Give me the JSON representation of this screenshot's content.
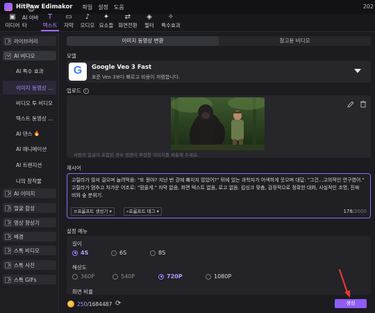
{
  "app": {
    "title": "HitPaw Edimakor",
    "menu": [
      "파일",
      "설정",
      "도움"
    ],
    "right_text": "202"
  },
  "toolbar": [
    {
      "icon": "media-icon",
      "glyph": "▣",
      "label": "미디어"
    },
    {
      "icon": "ai-avatar-icon",
      "glyph": "☺",
      "label": "AI 아바타"
    },
    {
      "icon": "text-icon",
      "glyph": "T",
      "label": "텍스트",
      "active": true
    },
    {
      "icon": "subtitle-icon",
      "glyph": "▭",
      "label": "자막"
    },
    {
      "icon": "audio-icon",
      "glyph": "♪",
      "label": "오디오"
    },
    {
      "icon": "elements-icon",
      "glyph": "✦",
      "label": "요소들"
    },
    {
      "icon": "transition-icon",
      "glyph": "⇄",
      "label": "화면전환"
    },
    {
      "icon": "filter-icon",
      "glyph": "◈",
      "label": "필터"
    },
    {
      "icon": "effects-icon",
      "glyph": "✧",
      "label": "특수효과"
    }
  ],
  "sidebar": {
    "library": "라이브러리",
    "ai_video": "AI 비디오",
    "sub_items": [
      "AI 특수 효과",
      "이미지 동영상 ...",
      "비디오 투 비디오",
      "텍스트 동영상 ...",
      "AI 댄스",
      "AI 애니메이션",
      "AI 트랜지션",
      "나의 창작물"
    ],
    "groups": [
      "AI 이미지",
      "얼굴 합성",
      "영상 향상기",
      "배경",
      "스톡 비디오",
      "스톡 사진",
      "스톡 GIFs"
    ]
  },
  "tabs": [
    "이미지 동영상 변환",
    "참고용 비디오"
  ],
  "model": {
    "label": "모델",
    "name": "Google Veo 3 Fast",
    "description": "표준 Veo 3보다 빠르고 비용이 저렴합니다.",
    "logo_letter": "G"
  },
  "upload": {
    "label": "업로드",
    "hint": "사람의 얼굴이 포함된 경우 정면이 뚜렷한 이미지를 제출해 주세요."
  },
  "prompt": {
    "label": "제시어",
    "text": "고릴라가 앉서 걸으며 늘려먹음: \"또 뭔야? 지난 번 강에 빠지지 않았어?\" 뒤에 있는 과학자가 어색하게 웃으며 대답: \"그건...고의적인 연구였어.\" 고릴라가 멈추고 차가운 어조로: \"맘을게.\" 자막 없음, 화면 텍스트 없음, 로고 없음. 립싱크 맞춤, 감정적으로 정확한 대화, 사실적인 조명, 진짜 비와 숲 분위기.",
    "generator_btn": "프롬프트 생성기",
    "tag_btn": "프롬프트 태그",
    "count": "178",
    "max": "/2000"
  },
  "settings": {
    "label": "설정 메뉴",
    "length_label": "길이",
    "length_options": [
      "4S",
      "6S",
      "8S"
    ],
    "length_selected": 0,
    "resolution_label": "해상도",
    "resolution_options": [
      "360P",
      "540P",
      "720P",
      "1080P"
    ],
    "resolution_selected": 2,
    "aspect_label": "화면 비율"
  },
  "footer": {
    "credits_used": "250",
    "credits_total": "/1684487",
    "generate_label": "생성"
  },
  "colors": {
    "accent": "#9b6cff",
    "button": "#8f5cf5",
    "arrow": "#e53935"
  }
}
